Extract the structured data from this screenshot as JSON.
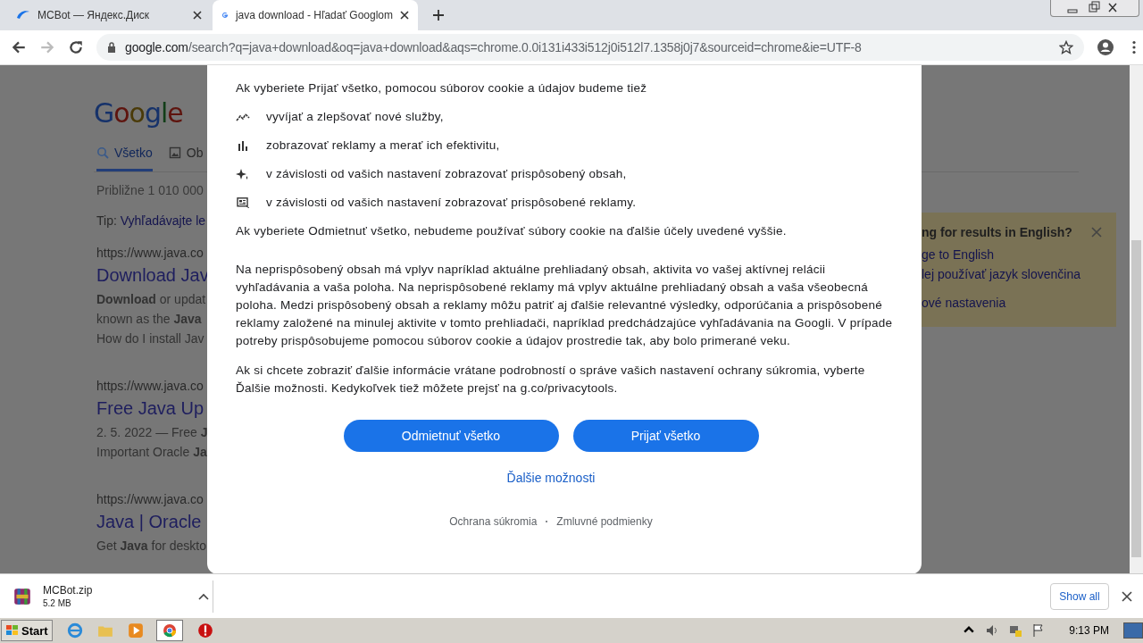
{
  "browser": {
    "tabs": [
      {
        "title": "MCBot — Яндекс.Диск",
        "selected": false
      },
      {
        "title": "java download - Hľadať Googlom",
        "selected": true
      }
    ],
    "address": {
      "domain": "google.com",
      "path": "/search?q=java+download&oq=java+download&aqs=chrome.0.0i131i433i512j0i512l7.1358j0j7&sourceid=chrome&ie=UTF-8"
    }
  },
  "background_page": {
    "logo": "Google",
    "nav_tabs": [
      {
        "label": "Všetko",
        "selected": true
      },
      {
        "label": "Ob",
        "selected": false
      }
    ],
    "result_stats": "Približne 1 010 000",
    "tip": {
      "label": "Tip:",
      "link": "Vyhľadávajte le"
    },
    "results": [
      {
        "url": "https://www.java.co",
        "title": "Download Jav",
        "snippet": [
          "**Download** or updat",
          "known as the **Java**"
        ],
        "link": "How do I install Jav"
      },
      {
        "url": "https://www.java.co",
        "title": "Free Java Up",
        "snippet": [
          "2. 5. 2022 — Free **J**",
          "Important Oracle **Ja**"
        ]
      },
      {
        "url": "https://www.java.co",
        "title": "Java | Oracle",
        "snippet": [
          "Get **Java** for deskto"
        ]
      }
    ],
    "language_card": {
      "title": "ng for results in English?",
      "links": [
        "ge to English",
        "lej používať jazyk slovenčina",
        "ové nastavenia"
      ]
    }
  },
  "consent_dialog": {
    "intro": "Ak vyberiete Prijať všetko, pomocou súborov cookie a údajov budeme tiež",
    "items": [
      {
        "kind": "trend",
        "text": "vyvíjať a zlepšovať nové služby,"
      },
      {
        "kind": "bars",
        "text": "zobrazovať reklamy a merať ich efektivitu,"
      },
      {
        "kind": "sparkle",
        "text": "v závislosti od vašich nastavení zobrazovať prispôsobený obsah,"
      },
      {
        "kind": "ad",
        "text": "v závislosti od vašich nastavení zobrazovať prispôsobené reklamy."
      }
    ],
    "reject_note": "Ak vyberiete Odmietnuť všetko, nebudeme používať súbory cookie na ďalšie účely uvedené vyššie.",
    "paragraphs": [
      "Na neprispôsobený obsah má vplyv napríklad aktuálne prehliadaný obsah, aktivita vo vašej aktívnej relácii vyhľadávania a vaša poloha. Na neprispôsobené reklamy má vplyv aktuálne prehliadaný obsah a vaša všeobecná poloha. Medzi prispôsobený obsah a reklamy môžu patriť aj ďalšie relevantné výsledky, odporúčania a prispôsobené reklamy založené na minulej aktivite v tomto prehliadači, napríklad predchádzajúce vyhľadávania na Googli. V prípade potreby prispôsobujeme pomocou súborov cookie a údajov prostredie tak, aby bolo primerané veku.",
      "Ak si chcete zobraziť ďalšie informácie vrátane podrobností o správe vašich nastavení ochrany súkromia, vyberte Ďalšie možnosti. Kedykoľvek tiež môžete prejsť na g.co/privacytools."
    ],
    "buttons": [
      "Odmietnuť všetko",
      "Prijať všetko"
    ],
    "more_options": "Ďalšie možnosti",
    "footer_links": [
      "Ochrana súkromia",
      "Zmluvné podmienky"
    ]
  },
  "downloads": {
    "file": "MCBot.zip",
    "size": "5.2 MB",
    "show_all": "Show all"
  },
  "taskbar": {
    "start": "Start",
    "clock": "9:13 PM"
  }
}
